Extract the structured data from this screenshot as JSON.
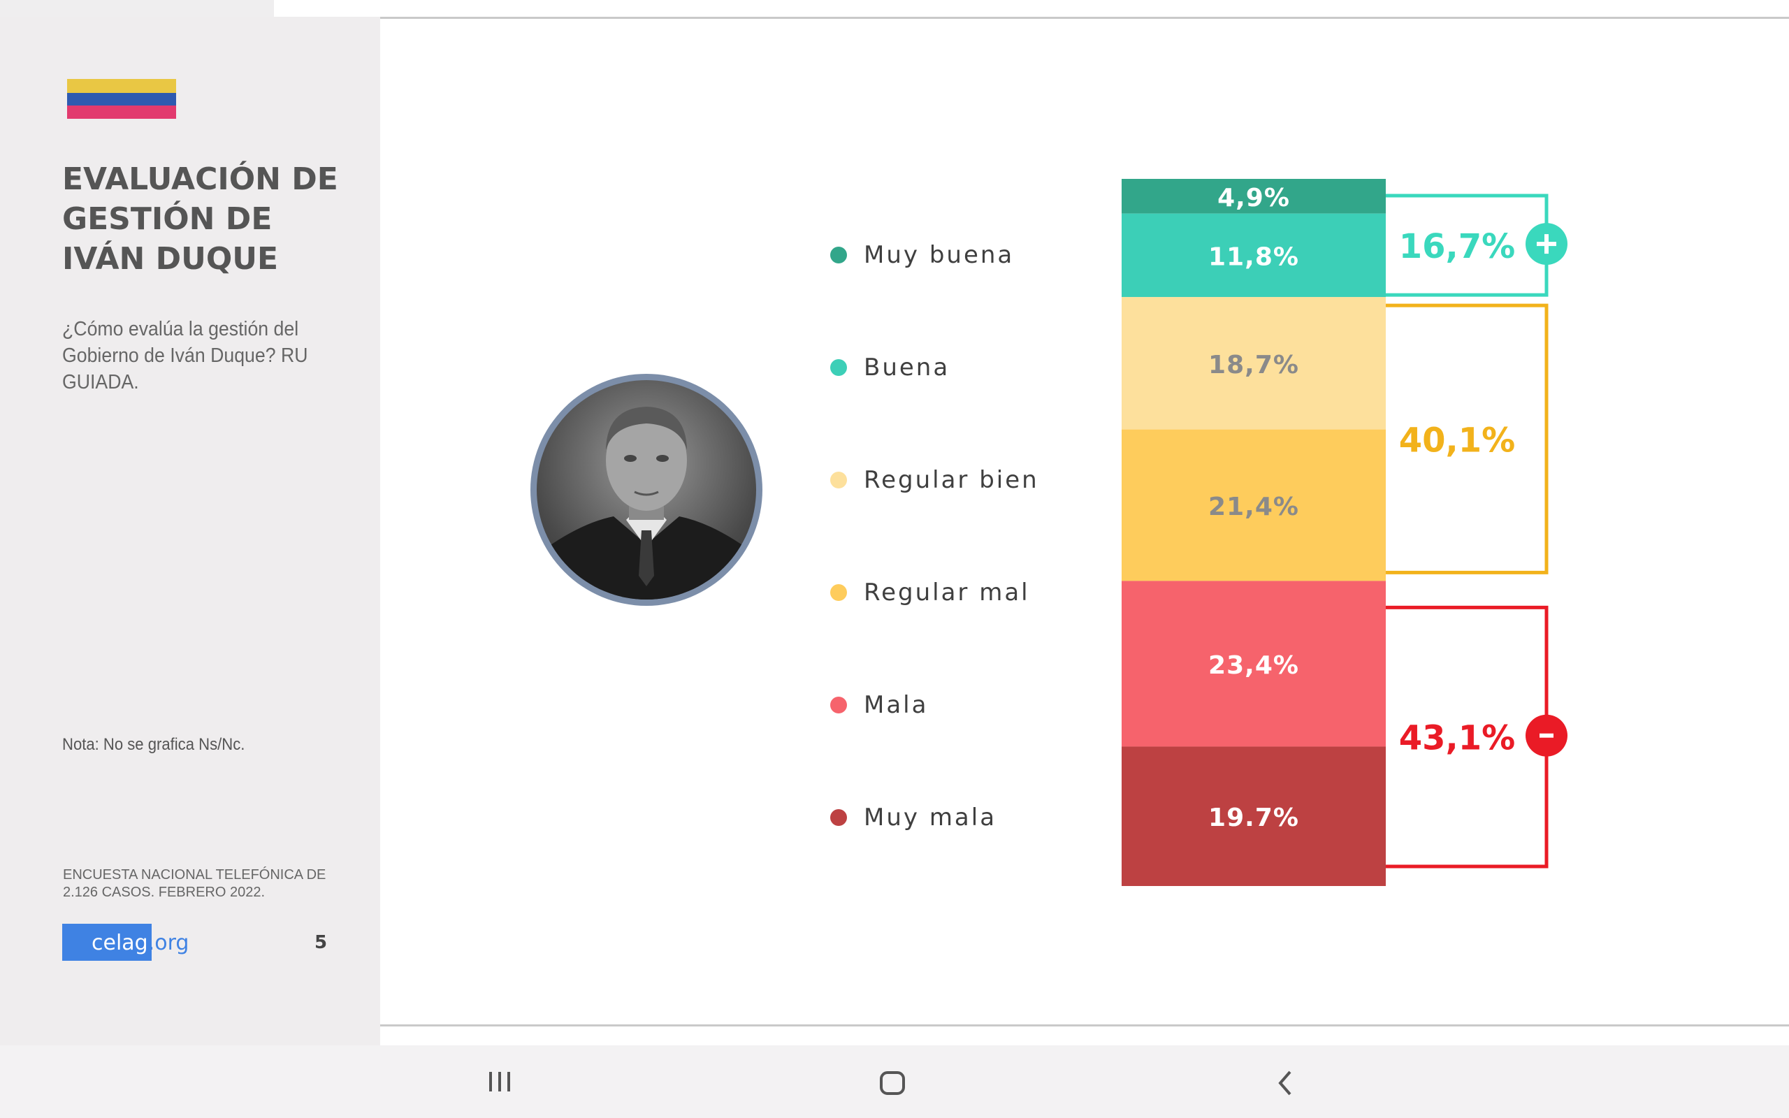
{
  "slide": {
    "title_lines": [
      "EVALUACIÓN DE",
      "GESTIÓN DE",
      "IVÁN DUQUE"
    ],
    "question": "¿Cómo evalúa la gestión del Gobierno de Iván Duque? RU GUIADA.",
    "note": "Nota: No se grafica Ns/Nc.",
    "source_lines": [
      "ENCUESTA NACIONAL TELEFÓNICA DE",
      "2.126 CASOS. FEBRERO 2022."
    ],
    "logo": {
      "main": "celag",
      "suffix": ".org"
    },
    "page_number": "5",
    "flag_colors": [
      "#e9c744",
      "#2e5ab0",
      "#e23a6e"
    ]
  },
  "chart_data": {
    "type": "bar",
    "subtype": "stacked-100",
    "categories": [
      "Muy buena",
      "Buena",
      "Regular bien",
      "Regular mal",
      "Mala",
      "Muy mala"
    ],
    "values": [
      4.9,
      11.8,
      18.7,
      21.4,
      23.4,
      19.7
    ],
    "value_labels": [
      "4,9%",
      "11,8%",
      "18,7%",
      "21,4%",
      "23,4%",
      "19.7%"
    ],
    "colors": [
      "#32a68a",
      "#3ccfb7",
      "#fde09c",
      "#fecc5c",
      "#f6636c",
      "#bd4142"
    ],
    "label_colors": [
      "#ffffff",
      "#ffffff",
      "#8a8a8a",
      "#8a8a8a",
      "#ffffff",
      "#ffffff"
    ],
    "groups": [
      {
        "label": "16,7%",
        "value": 16.7,
        "color": "#3ad8bd",
        "from": 0,
        "to": 1,
        "sign": "+"
      },
      {
        "label": "40,1%",
        "value": 40.1,
        "color": "#f2b21b",
        "from": 2,
        "to": 3,
        "sign": ""
      },
      {
        "label": "43,1%",
        "value": 43.1,
        "color": "#ea1b26",
        "from": 4,
        "to": 5,
        "sign": "-"
      }
    ]
  },
  "nav": {
    "icons": [
      "recent-apps-icon",
      "home-icon",
      "back-icon"
    ]
  }
}
